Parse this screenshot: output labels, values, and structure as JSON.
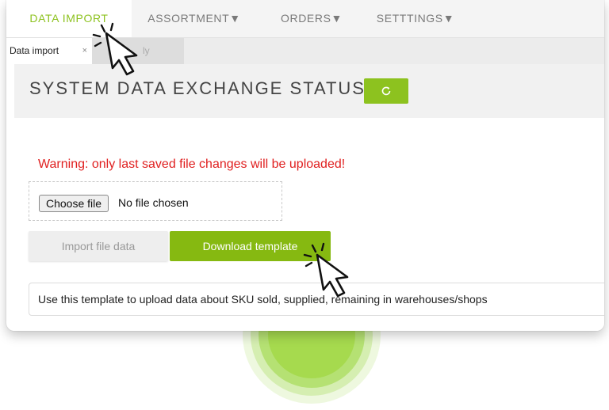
{
  "nav": {
    "items": [
      {
        "label": "DATA IMPORT",
        "active": true
      },
      {
        "label": "ASSORTMENT▼",
        "active": false
      },
      {
        "label": "ORDERS▼",
        "active": false
      },
      {
        "label": "SETTTINGS▼",
        "active": false
      }
    ]
  },
  "tabs": {
    "active_label": "Data import",
    "close_glyph": "×",
    "inactive_label": "ly"
  },
  "page": {
    "title": "SYSTEM DATA EXCHANGE STATUS",
    "refresh_icon": "refresh-icon"
  },
  "upload": {
    "warning": "Warning: only last saved file changes will be uploaded!",
    "choose_label": "Choose file",
    "no_file_text": "No file chosen",
    "import_label": "Import file data",
    "download_label": "Download template",
    "hint": "Use this template to upload data about SKU sold, supplied, remaining in warehouses/shops"
  },
  "colors": {
    "accent": "#8dc21f",
    "warning": "#e02020"
  }
}
